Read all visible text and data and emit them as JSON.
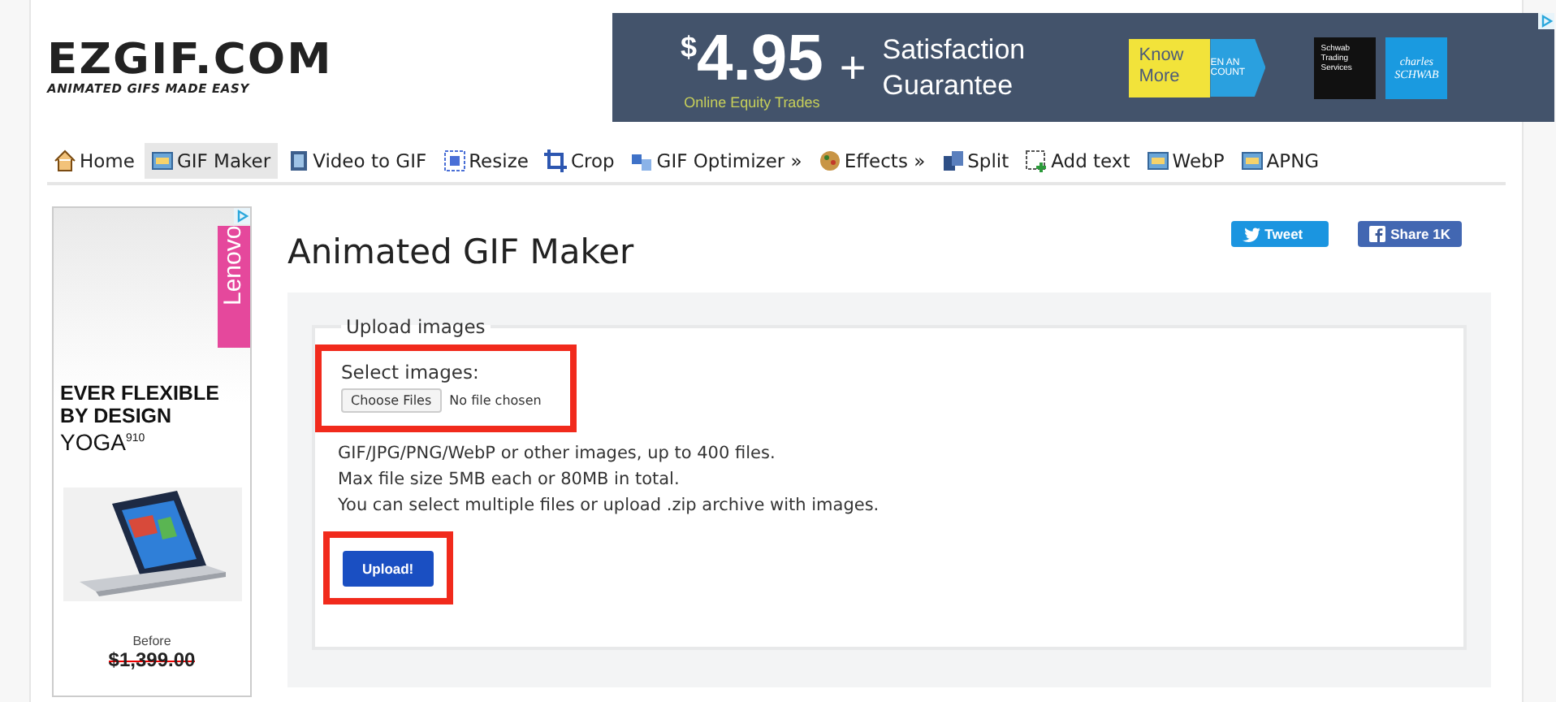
{
  "logo": {
    "title": "EZGIF.COM",
    "tagline": "ANIMATED GIFS MADE EASY"
  },
  "banner_ad": {
    "currency": "$",
    "price": "4.95",
    "plus": "+",
    "headline": "Satisfaction Guarantee",
    "subline": "Online Equity Trades",
    "cta": "Know More",
    "cta_behind": [
      "EN AN",
      "COUNT"
    ],
    "brand_box": "Schwab Trading Services",
    "brand": [
      "charles",
      "SCHWAB"
    ]
  },
  "nav": [
    {
      "label": "Home",
      "selected": false
    },
    {
      "label": "GIF Maker",
      "selected": true
    },
    {
      "label": "Video to GIF",
      "selected": false
    },
    {
      "label": "Resize",
      "selected": false
    },
    {
      "label": "Crop",
      "selected": false
    },
    {
      "label": "GIF Optimizer »",
      "selected": false
    },
    {
      "label": "Effects »",
      "selected": false
    },
    {
      "label": "Split",
      "selected": false
    },
    {
      "label": "Add text",
      "selected": false
    },
    {
      "label": "WebP",
      "selected": false
    },
    {
      "label": "APNG",
      "selected": false
    }
  ],
  "side_ad": {
    "brand": "Lenovo",
    "headline": "EVER FLEXIBLE BY DESIGN",
    "product": "YOGA$^{910}$",
    "before_label": "Before",
    "old_price": "$1,399.00"
  },
  "page_title": "Animated GIF Maker",
  "share": [
    {
      "kind": "twitter",
      "label": "Tweet"
    },
    {
      "kind": "facebook",
      "label": "Share 1K"
    }
  ],
  "upload": {
    "legend": "Upload images",
    "select_label": "Select images:",
    "file_button": "Choose Files",
    "file_status": "No file chosen",
    "select_highlighted": true,
    "notes": [
      "GIF/JPG/PNG/WebP or other images, up to 400 files.",
      "Max file size 5MB each or 80MB in total.",
      "You can select multiple files or upload .zip archive with images."
    ],
    "submit": "Upload!",
    "submit_highlighted": true
  }
}
